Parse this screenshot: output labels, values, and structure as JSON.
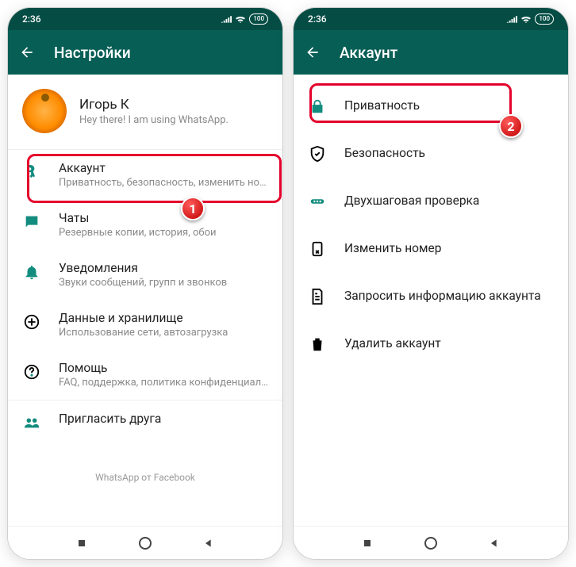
{
  "status": {
    "time": "2:36",
    "battery": "100"
  },
  "left": {
    "title": "Настройки",
    "profile": {
      "name": "Игорь К",
      "status": "Hey there! I am using WhatsApp."
    },
    "items": [
      {
        "icon": "key",
        "title": "Аккаунт",
        "sub": "Приватность, безопасность, изменить номер"
      },
      {
        "icon": "chat",
        "title": "Чаты",
        "sub": "Резервные копии, история, обои"
      },
      {
        "icon": "bell",
        "title": "Уведомления",
        "sub": "Звуки сообщений, групп и звонков"
      },
      {
        "icon": "data",
        "title": "Данные и хранилище",
        "sub": "Использование сети, автозагрузка"
      },
      {
        "icon": "help",
        "title": "Помощь",
        "sub": "FAQ, поддержка, политика конфиденциальн…"
      },
      {
        "icon": "people",
        "title": "Пригласить друга",
        "sub": ""
      }
    ],
    "footer": "WhatsApp от Facebook"
  },
  "right": {
    "title": "Аккаунт",
    "items": [
      {
        "icon": "lock",
        "title": "Приватность"
      },
      {
        "icon": "shield",
        "title": "Безопасность"
      },
      {
        "icon": "dots",
        "title": "Двухшаговая проверка"
      },
      {
        "icon": "sim",
        "title": "Изменить номер"
      },
      {
        "icon": "doc",
        "title": "Запросить информацию аккаунта"
      },
      {
        "icon": "trash",
        "title": "Удалить аккаунт"
      }
    ]
  },
  "markers": {
    "one": "1",
    "two": "2"
  }
}
